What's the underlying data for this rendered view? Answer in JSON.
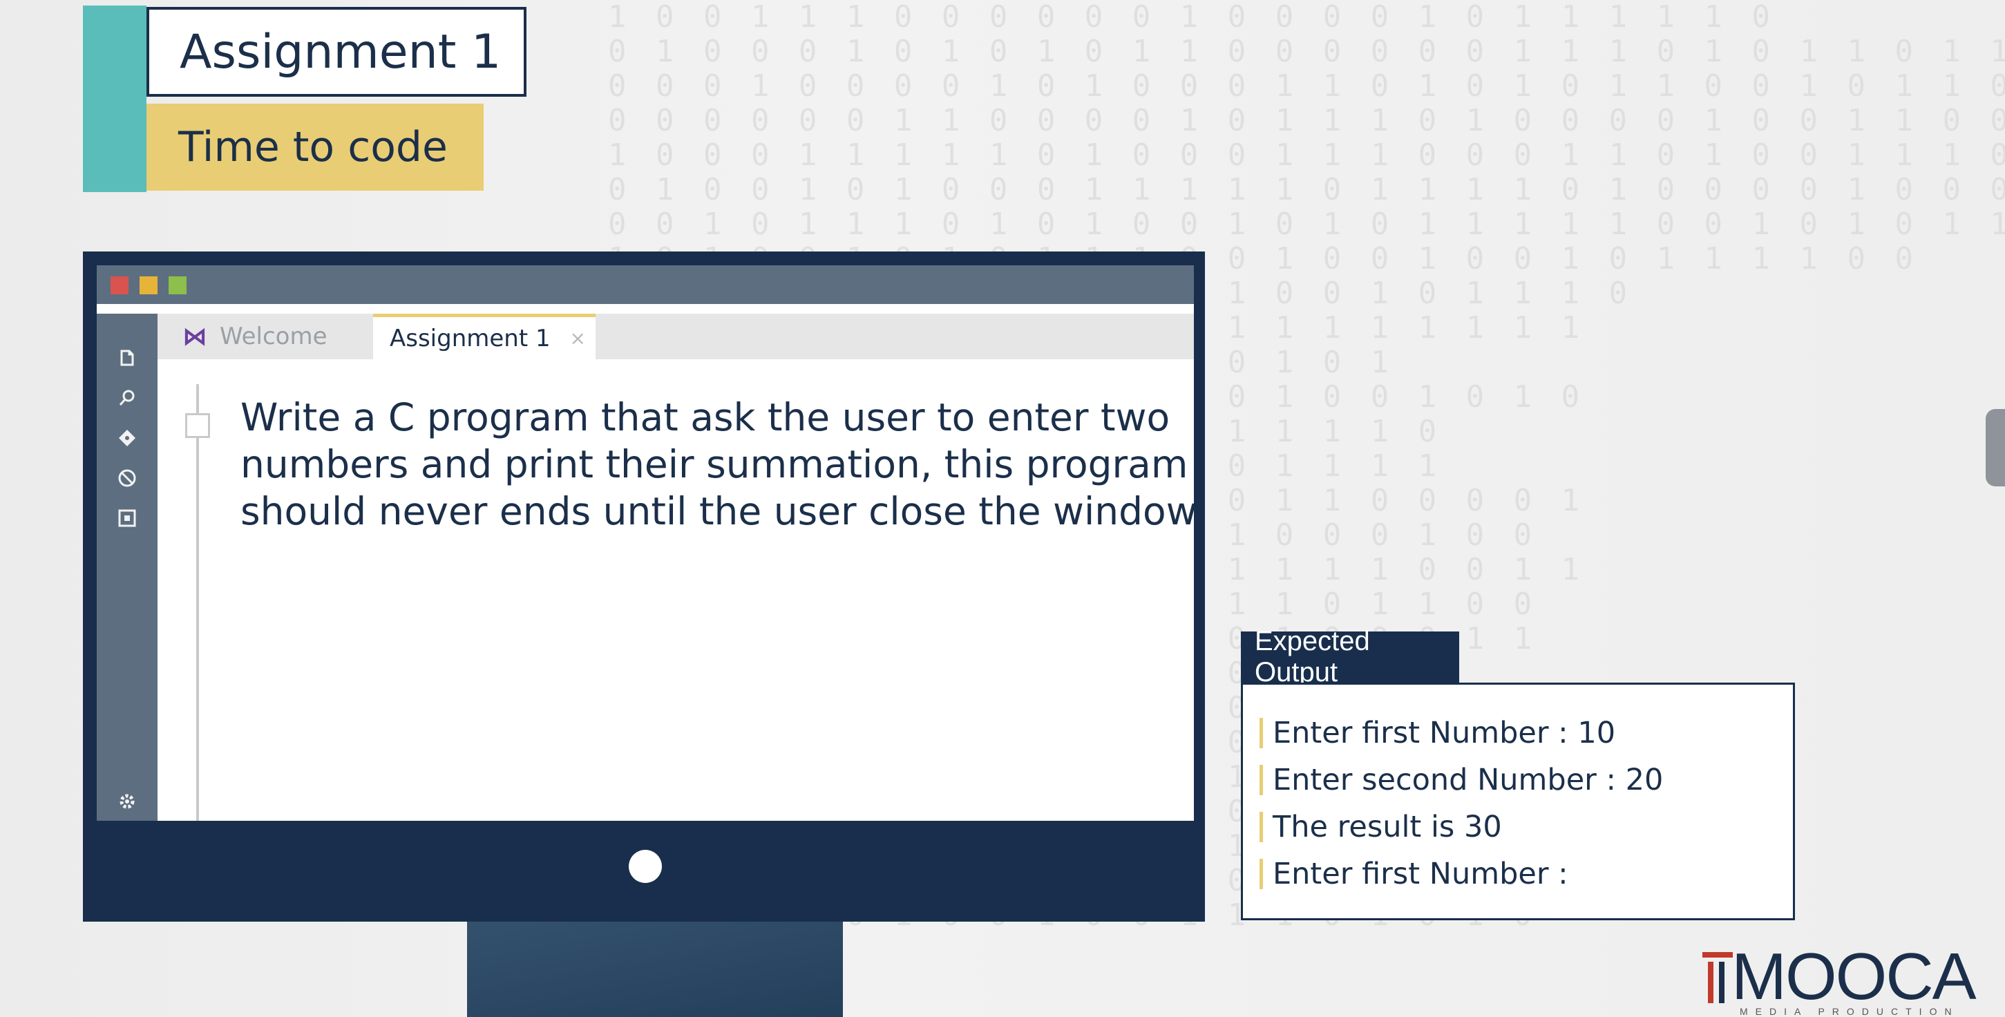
{
  "header": {
    "title": "Assignment 1",
    "subtitle": "Time to code"
  },
  "editor": {
    "tabs": [
      {
        "label": "Welcome",
        "active": false
      },
      {
        "label": "Assignment 1",
        "active": true,
        "close": "×"
      }
    ],
    "lines": [
      "Write a C program that ask the user to enter two",
      "numbers and print their summation, this program",
      "should never ends until the user close the window."
    ],
    "sidebar_icons": [
      "files-icon",
      "search-icon",
      "git-icon",
      "debug-icon",
      "extensions-icon",
      "settings-icon"
    ],
    "window_buttons": [
      "#d9534f",
      "#e7b43a",
      "#8cbf4b"
    ]
  },
  "expected_output": {
    "heading": "Expected Output",
    "lines": [
      "Enter first Number : 10",
      "Enter second Number : 20",
      "The result is 30",
      "Enter first Number :"
    ]
  },
  "logo": {
    "text": "MOOCA",
    "tagline": "MEDIA PRODUCTION"
  },
  "colors": {
    "navy": "#182e4c",
    "teal": "#5bbdba",
    "yellow": "#e9cd74",
    "rail": "#5d6e80"
  }
}
